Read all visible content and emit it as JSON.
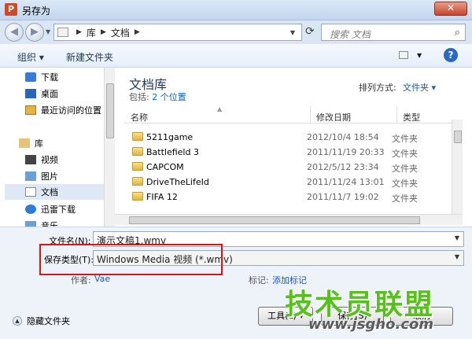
{
  "window": {
    "title": "另存为",
    "app_icon_letter": "P",
    "close_label": "✕"
  },
  "nav": {
    "back_icon": "back-arrow-icon",
    "forward_icon": "forward-arrow-icon",
    "breadcrumb": [
      "库",
      "文档"
    ],
    "search_placeholder": "搜索 文档"
  },
  "toolbar": {
    "organize": "组织 ▾",
    "new_folder": "新建文件夹",
    "help": "?"
  },
  "sidebar": {
    "items": [
      {
        "label": "下载",
        "icon": "download-folder-icon"
      },
      {
        "label": "桌面",
        "icon": "desktop-icon"
      },
      {
        "label": "最近访问的位置",
        "icon": "recent-places-icon"
      },
      {
        "label": "库",
        "icon": "library-icon"
      },
      {
        "label": "视频",
        "icon": "video-library-icon"
      },
      {
        "label": "图片",
        "icon": "picture-library-icon"
      },
      {
        "label": "文档",
        "icon": "document-library-icon"
      },
      {
        "label": "迅雷下载",
        "icon": "thunder-download-icon"
      },
      {
        "label": "音乐",
        "icon": "music-library-icon"
      }
    ]
  },
  "content": {
    "library_title": "文档库",
    "includes_label": "包括:",
    "includes_link": "2 个位置",
    "sort_label": "排列方式:",
    "sort_value": "文件夹 ▾",
    "columns": {
      "name": "名称",
      "date": "修改日期",
      "type": "类型"
    },
    "files": [
      {
        "name": "5211game",
        "date": "2012/10/4 18:54",
        "type": "文件夹"
      },
      {
        "name": "Battlefield 3",
        "date": "2011/11/19 20:33",
        "type": "文件夹"
      },
      {
        "name": "CAPCOM",
        "date": "2012/5/12 23:34",
        "type": "文件夹"
      },
      {
        "name": "DriveTheLifeId",
        "date": "2011/11/24 13:01",
        "type": "文件夹"
      },
      {
        "name": "FIFA 12",
        "date": "2011/11/7 19:02",
        "type": "文件夹"
      }
    ]
  },
  "form": {
    "filename_label": "文件名(N):",
    "filename_value": "演示文稿1.wmv",
    "filetype_label": "保存类型(T):",
    "filetype_value": "Windows Media 视频 (*.wmv)",
    "author_label": "作者:",
    "author_value": "Vae",
    "tags_label": "标记:",
    "tags_value": "添加标记"
  },
  "footer": {
    "hide_folders": "隐藏文件夹",
    "tools_button": "工具(L) ▾",
    "save_button": "保存(S)",
    "cancel_button": "取消"
  },
  "watermark": {
    "main": "技术员联盟",
    "url": "www.jsgho.com"
  }
}
